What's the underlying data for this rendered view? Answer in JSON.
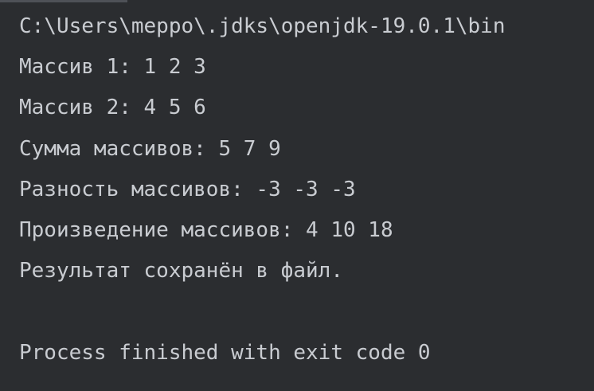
{
  "console": {
    "command_line": "C:\\Users\\meppo\\.jdks\\openjdk-19.0.1\\bin",
    "output": [
      "Массив 1: 1 2 3",
      "Массив 2: 4 5 6",
      "Сумма массивов: 5 7 9",
      "Разность массивов: -3 -3 -3",
      "Произведение массивов: 4 10 18",
      "Результат сохранён в файл."
    ],
    "exit_message": "Process finished with exit code 0"
  }
}
